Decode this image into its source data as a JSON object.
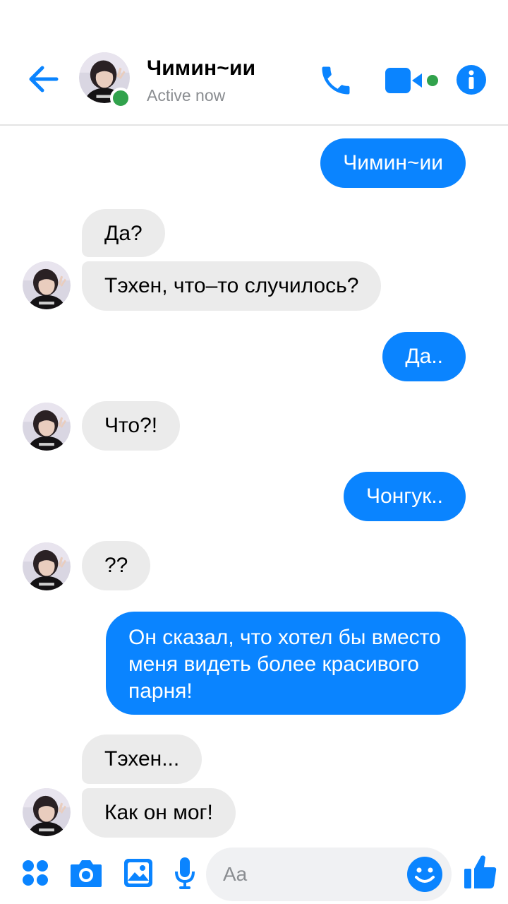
{
  "header": {
    "contact_name": "Чимин~ии",
    "status": "Active now",
    "icons": [
      "back-arrow-icon",
      "phone-icon",
      "video-camera-icon",
      "info-icon"
    ]
  },
  "messages": [
    {
      "side": "sent",
      "text": "Чимин~ии"
    },
    {
      "side": "received",
      "text": "Да?"
    },
    {
      "side": "received",
      "text": "Тэхен, что–то случилось?"
    },
    {
      "side": "sent",
      "text": "Да.."
    },
    {
      "side": "received",
      "text": "Что?!"
    },
    {
      "side": "sent",
      "text": "Чонгук.."
    },
    {
      "side": "received",
      "text": "??"
    },
    {
      "side": "sent",
      "text": "Он сказал, что хотел бы вместо меня видеть более красивого парня!"
    },
    {
      "side": "received",
      "text": "Тэхен..."
    },
    {
      "side": "received",
      "text": "Как он мог!"
    }
  ],
  "composer": {
    "placeholder": "Aa",
    "icons": [
      "menu-dots-icon",
      "camera-icon",
      "gallery-icon",
      "microphone-icon",
      "emoji-icon",
      "thumbs-up-icon"
    ]
  },
  "colors": {
    "accent": "#0a84ff",
    "online": "#31a24c",
    "received_bubble": "#ebebeb"
  }
}
